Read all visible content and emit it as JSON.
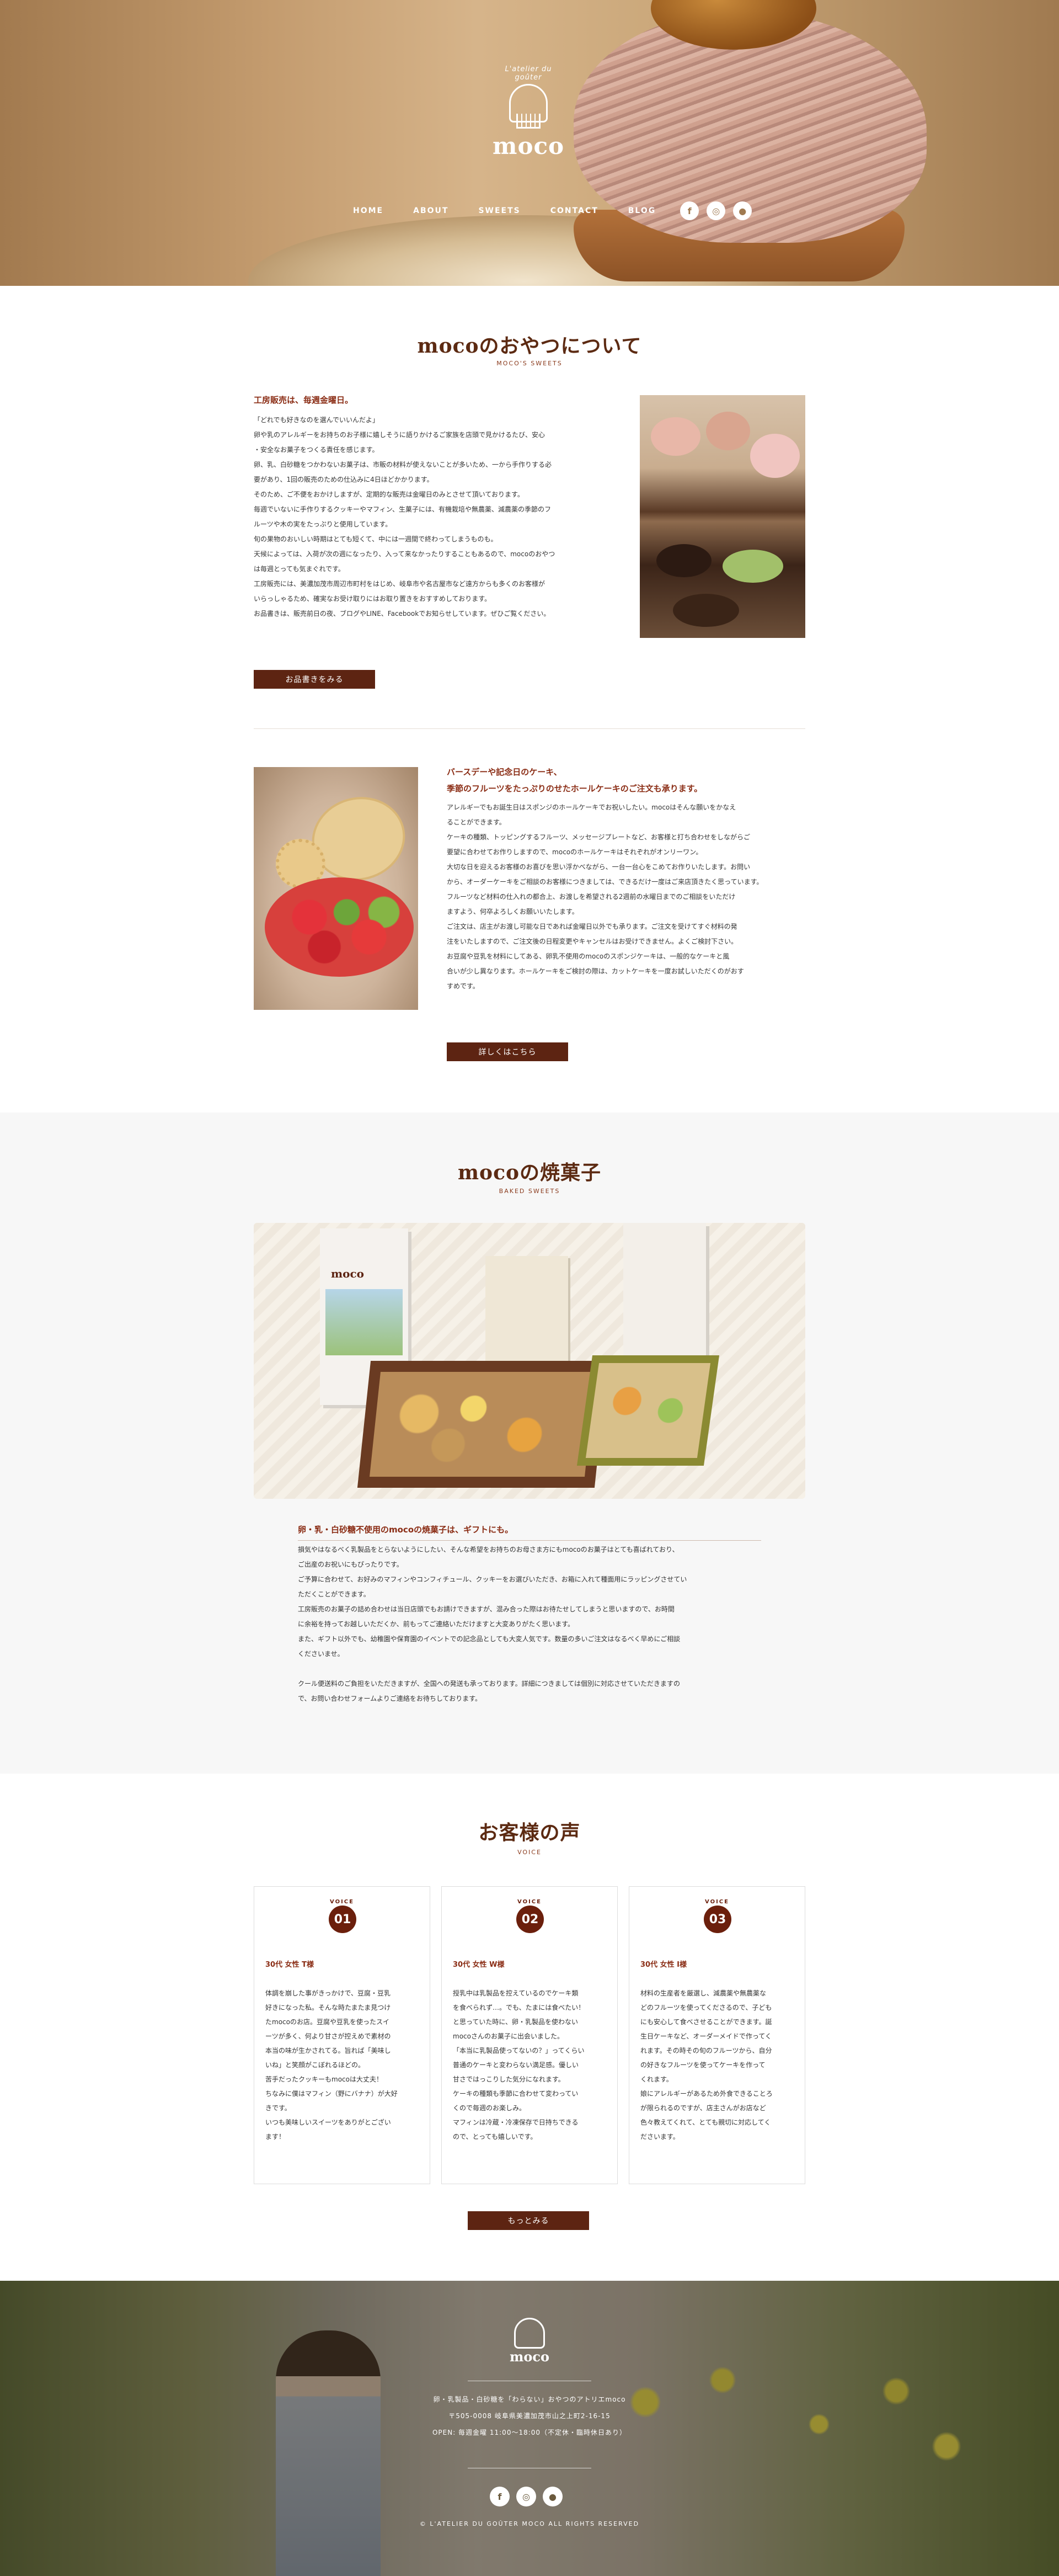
{
  "hero": {
    "logo_arch": "L'atelier du goûter",
    "logo_word": "moco",
    "nav": [
      "HOME",
      "ABOUT",
      "SWEETS",
      "CONTACT",
      "BLOG"
    ],
    "sns_icons": [
      "facebook-icon",
      "instagram-icon",
      "line-icon"
    ]
  },
  "about": {
    "title": "mocoのおやつについて",
    "sub": "MOCO'S SWEETS",
    "lead": "工房販売は、毎週金曜日。",
    "paragraphs": [
      "「どれでも好きなのを選んでいいんだよ」",
      "卵や乳のアレルギーをお持ちのお子様に嬉しそうに語りかけるご家族を店頭で見かけるたび、安心",
      "・安全なお菓子をつくる責任を感じます。",
      "卵、乳、白砂糖をつかわないお菓子は、市販の材料が使えないことが多いため、一から手作りする必",
      "要があり、1回の販売のための仕込みに4日ほどかかります。",
      "そのため、ご不便をおかけしますが、定期的な販売は金曜日のみとさせて頂いております。",
      "毎週でいないに手作りするクッキーやマフィン、生菓子には、有機栽培や無農薬、減農薬の季節のフ",
      "ルーツや木の実をたっぷりと使用しています。",
      "旬の果物のおいしい時期はとても短くて、中には一週間で終わってしまうものも。",
      "天候によっては、入荷が次の週になったり、入って来なかったりすることもあるので、mocoのおやつ",
      "は毎週とっても気まぐれです。",
      "工房販売には、美濃加茂市周辺市町村をはじめ、岐阜市や名古屋市など遠方からも多くのお客様が",
      "いらっしゃるため、確実なお受け取りにはお取り置きをおすすめしております。",
      "お品書きは、販売前日の夜、ブログやLINE、Facebookでお知らせしています。ぜひご覧ください。"
    ],
    "button": "お品書きをみる"
  },
  "cake": {
    "lead1": "バースデーや記念日のケーキ、",
    "lead2": "季節のフルーツをたっぷりのせたホールケーキのご注文も承ります。",
    "paragraphs": [
      "アレルギーでもお誕生日はスポンジのホールケーキでお祝いしたい。mocoはそんな願いをかなえ",
      "ることができます。",
      "ケーキの種類、トッピングするフルーツ、メッセージプレートなど、お客様と打ち合わせをしながらご",
      "要望に合わせてお作りしますので、mocoのホールケーキはそれぞれがオンリーワン。",
      "大切な日を迎えるお客様のお喜びを思い浮かべながら、一台一台心をこめてお作りいたします。お問い",
      "から、オーダーケーキをご相談のお客様につきましては、できるだけ一度はご来店頂きたく思っています。",
      "フルーツなど材料の仕入れの都合上、お渡しを希望される2週前の水曜日までのご相談をいただけ",
      "ますよう、何卒よろしくお願いいたします。",
      "ご注文は、店主がお渡し可能な日であれば金曜日以外でも承ります。ご注文を受けてすぐ材料の発",
      "注をいたしますので、ご注文後の日程変更やキャンセルはお受けできません。よくご検討下さい。",
      "お豆腐や豆乳を材料にしてある、卵乳不使用のmocoのスポンジケーキは、一般的なケーキと風",
      "合いが少し異なります。ホールケーキをご検討の際は、カットケーキを一度お試しいただくのがおす",
      "すめです。"
    ],
    "button": "詳しくはこちら"
  },
  "baked": {
    "title": "mocoの焼菓子",
    "sub": "BAKED SWEETS",
    "lead": "卵・乳・白砂糖不使用のmocoの焼菓子は、ギフトにも。",
    "box_label": "moco",
    "paragraphs": [
      "損気やはなるべく乳製品をとらないようにしたい、そんな希望をお持ちのお母さま方にもmocoのお菓子はとても喜ばれており、",
      "ご出産のお祝いにもぴったりです。",
      "ご予算に合わせて、お好みのマフィンやコンフィチュール、クッキーをお選びいただき、お箱に入れて種面用にラッピングさせてい",
      "ただくことができます。",
      "工房販売のお菓子の詰め合わせは当日店頭でもお請けできますが、混み合った際はお待たせしてしまうと思いますので、お時間",
      "に余裕を持ってお越しいただくか、前もってご連絡いただけますと大変ありがたく思います。",
      "また、ギフト以外でも、幼稚園や保育園のイベントでの記念品としても大変人気です。数量の多いご注文はなるべく早めにご相談",
      "くださいませ。",
      "",
      "クール便送料のご負担をいただきますが、全国への発送も承っております。詳細につきましては個別に対応させていただきますの",
      "で、お問い合わせフォームよりご連絡をお待ちしております。"
    ]
  },
  "voice": {
    "title": "お客様の声",
    "sub": "VOICE",
    "badge_label": "VOICE",
    "cards": [
      {
        "num": "01",
        "who": "30代 女性 T様",
        "lines": [
          "体調を崩した事がきっかけで、豆腐・豆乳",
          "好きになった私。そんな時たまたま見つけ",
          "たmocoのお店。豆腐や豆乳を使ったスイ",
          "ーツが多く、何より甘さが控えめで素材の",
          "本当の味が生かされてる。旨れば「美味し",
          "いね」と笑顔がこぼれるほどの。",
          "苦手だったクッキーもmocoは大丈夫！",
          "ちなみに僕はマフィン（野にバナナ）が大好",
          "きです。",
          "いつも美味しいスイーツをありがとござい",
          "ます！"
        ]
      },
      {
        "num": "02",
        "who": "30代 女性 W様",
        "lines": [
          "授乳中は乳製品を控えているのでケーキ類",
          "を食べられず…。でも、たまには食べたい！",
          "と思っていた時に、卵・乳製品を使わない",
          "mocoさんのお菓子に出会いました。",
          "「本当に乳製品使ってないの？」ってくらい",
          "普通のケーキと変わらない満足感。優しい",
          "甘さではっこりした気分になれます。",
          "ケーキの種類も季節に合わせて変わってい",
          "くので毎週のお楽しみ。",
          "マフィンは冷蔵・冷凍保存で日持ちできる",
          "ので、とっても嬉しいです。"
        ]
      },
      {
        "num": "03",
        "who": "30代 女性 I様",
        "lines": [
          "材料の生産者を厳選し、減農薬や無農薬な",
          "どのフルーツを使ってくださるので、子ども",
          "にも安心して食べさせることができます。誕",
          "生日ケーキなど、オーダーメイドで作ってく",
          "れます。その時その旬のフルーツから、自分",
          "の好きなフルーツを使ってケーキを作って",
          "くれます。",
          "娘にアレルギーがあるため外食できることろ",
          "が限られるのですが、店主さんがお店など",
          "色々教えてくれて、とても親切に対応してく",
          "ださいます。"
        ]
      }
    ],
    "button": "もっとみる"
  },
  "footer": {
    "logo_word": "moco",
    "info": [
      "卵・乳製品・白砂糖を「わらない」おやつのアトリエmoco",
      "〒505-0008 岐阜県美濃加茂市山之上町2-16-15",
      "OPEN: 毎週金曜 11:00～18:00（不定休・臨時休日あり）"
    ],
    "copyright": "© L'ATELIER DU GOÛTER MOCO ALL RIGHTS RESERVED"
  }
}
